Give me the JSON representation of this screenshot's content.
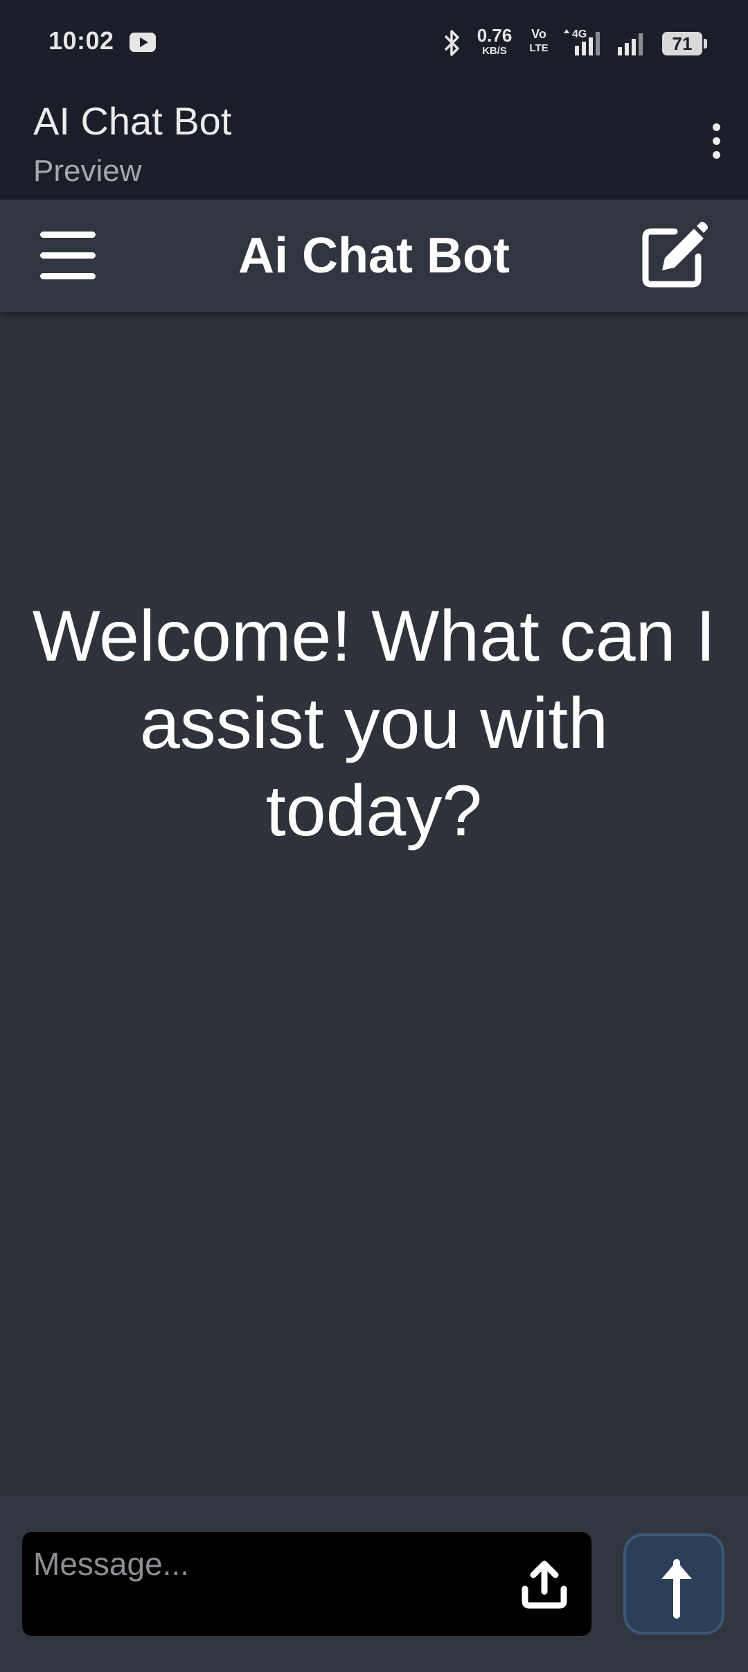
{
  "status_bar": {
    "time": "10:02",
    "net_speed_value": "0.76",
    "net_speed_unit": "KB/S",
    "volte_top": "Vo",
    "volte_bottom": "LTE",
    "network_type": "4G",
    "battery": "71",
    "icons": [
      "youtube-icon",
      "bluetooth-icon",
      "signal-icon",
      "battery-icon"
    ]
  },
  "app_bar": {
    "title": "AI Chat Bot",
    "subtitle": "Preview"
  },
  "header": {
    "title": "Ai Chat Bot"
  },
  "main": {
    "welcome_text": "Welcome! What can I assist you with today?"
  },
  "composer": {
    "placeholder": "Message...",
    "value": ""
  },
  "colors": {
    "status_bg": "#1b1e28",
    "header_bg": "#30363f",
    "main_bg": "#2e333b",
    "input_bg": "#000000",
    "send_bg": "#2c3f58"
  }
}
